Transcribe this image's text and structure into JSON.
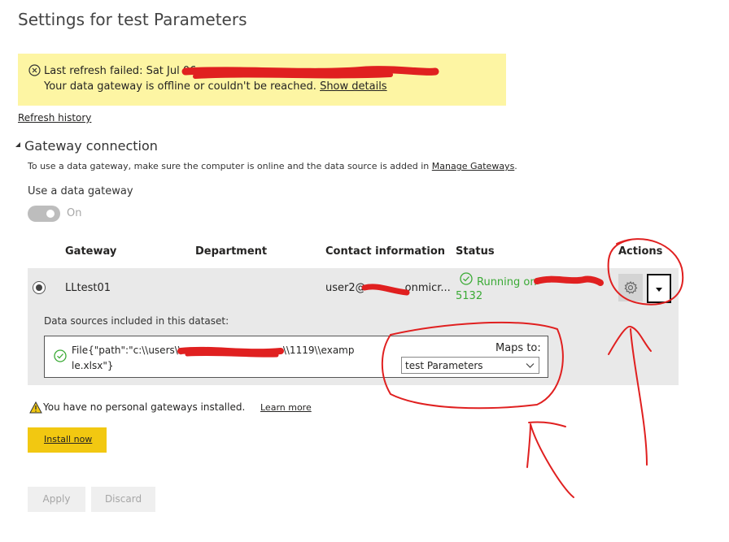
{
  "page": {
    "title": "Settings for test Parameters"
  },
  "banner": {
    "line1": "Last refresh failed: Sat Jul 06",
    "line2": "Your data gateway is offline or couldn't be reached.",
    "show_details": "Show details",
    "icon": "error-circle-x-icon"
  },
  "refresh_history": "Refresh history",
  "gateway_section": {
    "title": "Gateway connection",
    "description": "To use a data gateway, make sure the computer is online and the data source is added in",
    "manage_link": "Manage Gateways",
    "use_gateway_label": "Use a data gateway",
    "toggle_state": "On"
  },
  "table": {
    "headers": [
      "Gateway",
      "Department",
      "Contact information",
      "Status",
      "Actions"
    ],
    "row": {
      "gateway": "LLtest01",
      "contact": "user2@",
      "contact_tail": "onmicr...",
      "status_line1": "Running on",
      "status_line2": "5132"
    }
  },
  "datasources": {
    "title": "Data sources included in this dataset:",
    "path_line1": "File{\"path\":\"c:\\\\users\\\\",
    "path_mid": "\\\\1119\\\\examp",
    "path_line2": "le.xlsx\"}",
    "maps_to_label": "Maps to:",
    "maps_to_value": "test Parameters"
  },
  "personal": {
    "warning": "You have no personal gateways installed.",
    "learn_more": "Learn more",
    "install_now": "Install now"
  },
  "footer": {
    "apply": "Apply",
    "discard": "Discard"
  },
  "colors": {
    "banner_bg": "#fdf5a3",
    "status_green": "#3aaa35",
    "install_yellow": "#f2c811",
    "annotation_red": "#e02020"
  }
}
